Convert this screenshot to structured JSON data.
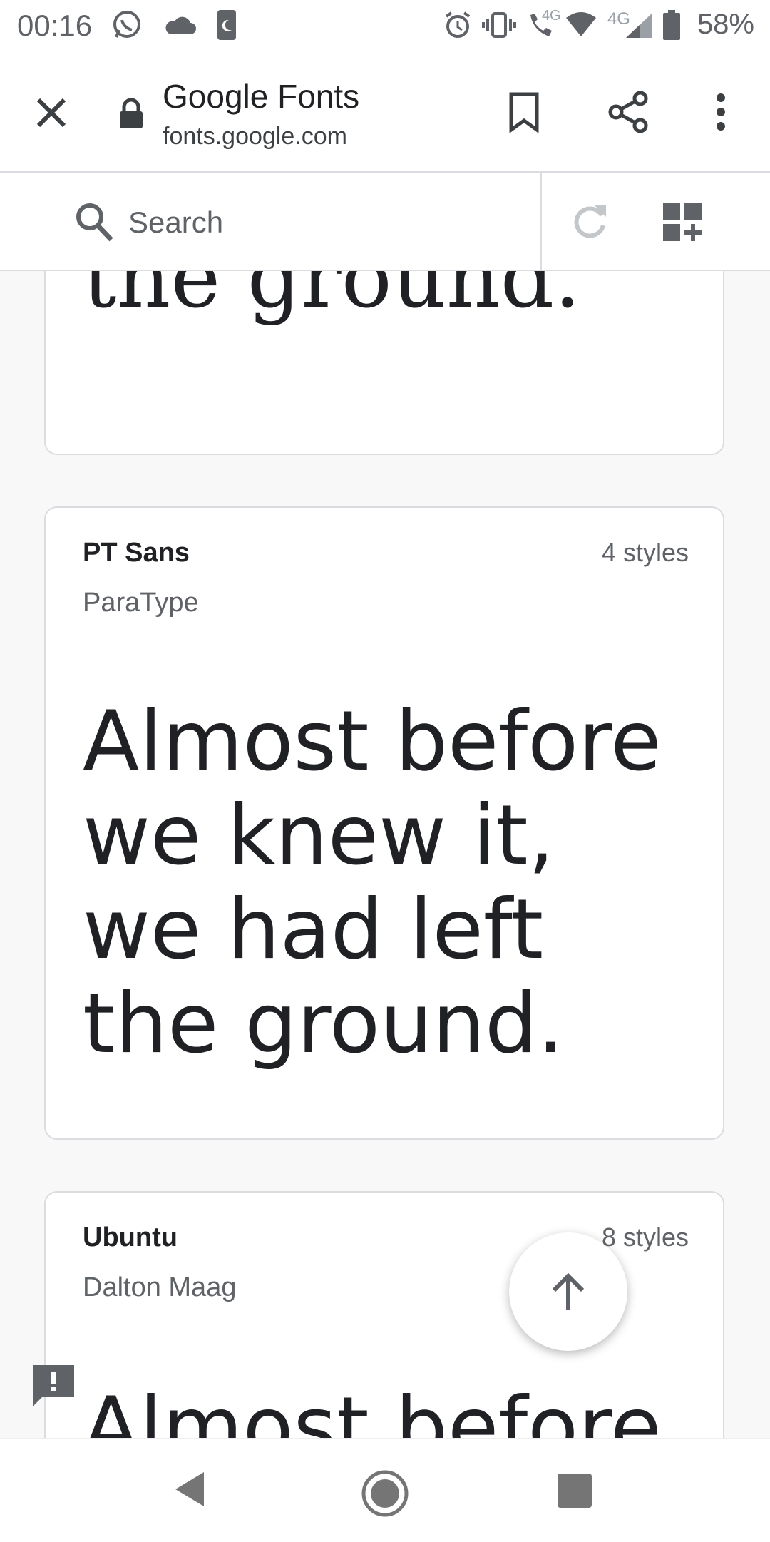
{
  "status_bar": {
    "time": "00:16",
    "battery": "58%",
    "network_label_1": "4G",
    "network_label_2": "4G",
    "icons": [
      "whatsapp-icon",
      "cloud-icon",
      "phone-moon-icon",
      "alarm-icon",
      "vibrate-icon",
      "wifi-call-icon",
      "wifi-icon",
      "signal-icon",
      "battery-icon"
    ]
  },
  "toolbar": {
    "title": "Google Fonts",
    "url": "fonts.google.com",
    "icons": [
      "close-icon",
      "lock-icon",
      "bookmark-icon",
      "share-icon",
      "more-vert-icon"
    ]
  },
  "search": {
    "placeholder": "Search",
    "icons": [
      "search-icon",
      "refresh-icon",
      "add-to-collection-icon"
    ]
  },
  "cards": [
    {
      "sample": "the ground."
    },
    {
      "name": "PT Sans",
      "foundry": "ParaType",
      "styles": "4 styles",
      "sample": "Almost before we knew it, we had left the ground."
    },
    {
      "name": "Ubuntu",
      "foundry": "Dalton Maag",
      "styles": "8 styles",
      "sample": "Almost before"
    }
  ],
  "colors": {
    "text": "#202124",
    "secondary": "#5f6368",
    "border": "#dadce0",
    "background": "#f8f8f8"
  }
}
